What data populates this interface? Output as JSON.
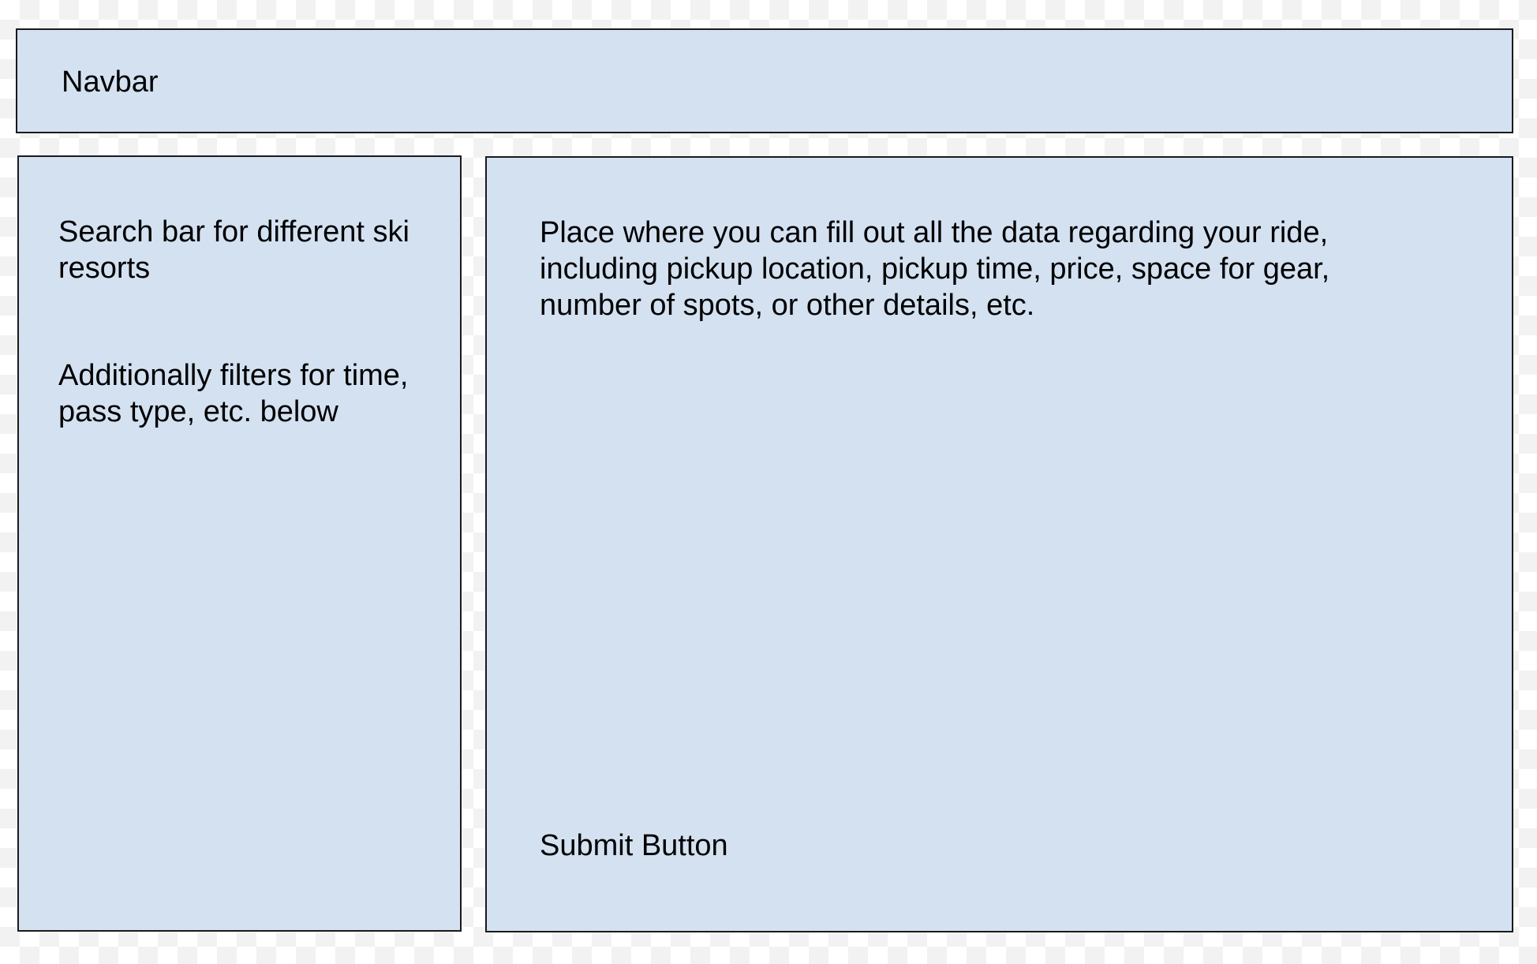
{
  "colors": {
    "box_fill": "#d4e1f1",
    "box_border": "#1a1a1a",
    "text": "#000000"
  },
  "navbar": {
    "label": "Navbar"
  },
  "sidebar": {
    "search_text": "Search bar for different ski resorts",
    "filters_text": "Additionally filters for time, pass type, etc. below"
  },
  "form": {
    "description": "Place where you can fill out all the data regarding your ride, including pickup location, pickup time, price, space for gear, number of spots, or other details, etc.",
    "submit_label": "Submit Button"
  }
}
